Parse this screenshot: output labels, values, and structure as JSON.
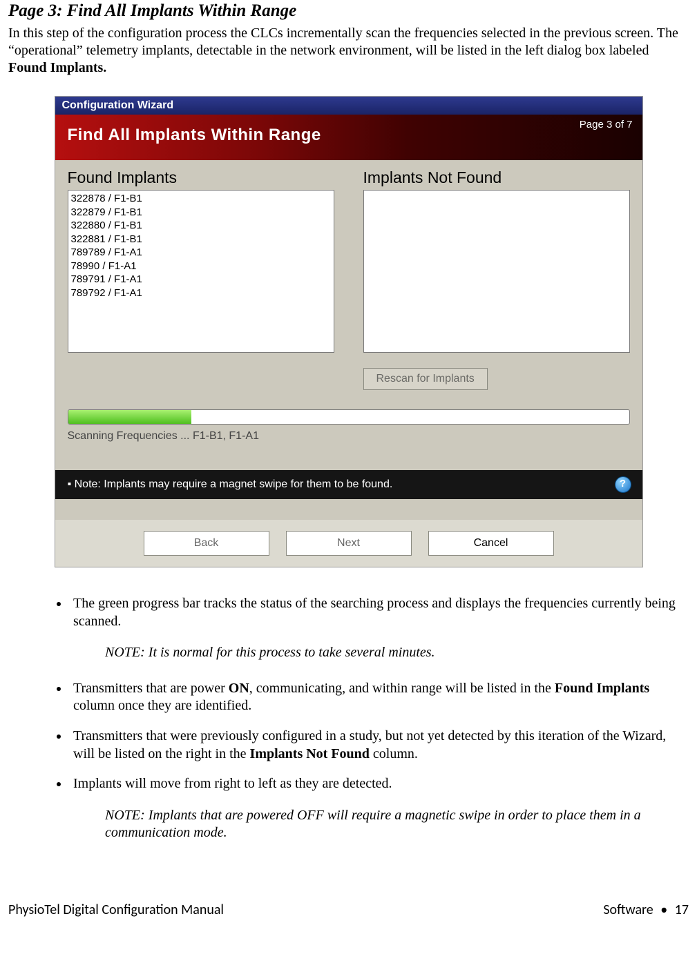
{
  "section_title": "Page 3: Find All Implants Within Range",
  "intro_html": "In this step of the configuration process the CLCs incrementally scan the frequencies selected in the previous screen. The “operational” telemetry implants, detectable in the network environment, will be listed in the left dialog box labeled <b>Found Implants.</b>",
  "wizard": {
    "titlebar": "Configuration Wizard",
    "page_indicator": "Page 3 of 7",
    "header_title": "Find All Implants Within Range",
    "found_label": "Found Implants",
    "not_found_label": "Implants Not Found",
    "found_items": [
      "322878 / F1-B1",
      "322879 / F1-B1",
      "322880 / F1-B1",
      "322881 / F1-B1",
      "789789 / F1-A1",
      "78990 / F1-A1",
      "789791 / F1-A1",
      "789792 / F1-A1"
    ],
    "not_found_items": [],
    "rescan_label": "Rescan for Implants",
    "scan_status": "Scanning Frequencies   ...   F1-B1, F1-A1",
    "note_text": "▪ Note: Implants may require a magnet swipe for them to be found.",
    "help_glyph": "?",
    "buttons": {
      "back": "Back",
      "next": "Next",
      "cancel": "Cancel"
    }
  },
  "bullets": {
    "b1_html": "The green progress bar tracks the status of the searching process and displays the frequencies currently being scanned.",
    "note1": "NOTE: It is normal for this process to take several minutes.",
    "b2_html": "Transmitters that are power <b>ON</b>, communicating, and within range will be listed in the <b>Found Implants</b> column once they are identified.",
    "b3_html": "Transmitters that were previously configured in a study, but not yet detected by this iteration of the Wizard, will be listed on the right in the <b>Implants Not Found</b> column.",
    "b4_html": "Implants will move from right to left as they are detected.",
    "note2": "NOTE: Implants that are powered OFF will require a magnetic swipe in order to place them in a communication mode."
  },
  "footer": {
    "left": "PhysioTel Digital Configuration Manual",
    "right_section": "Software",
    "right_page": "17"
  }
}
